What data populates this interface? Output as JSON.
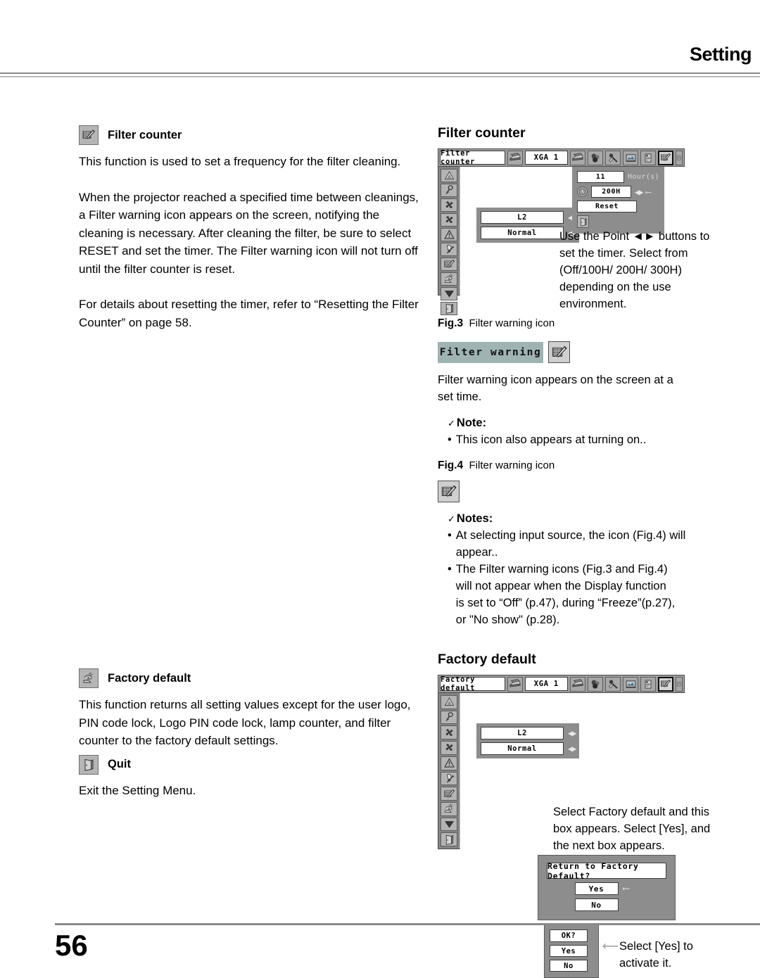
{
  "header": {
    "title": "Setting"
  },
  "footer": {
    "page_number": "56"
  },
  "left_column": {
    "sections": [
      {
        "icon": "filter-counter-icon",
        "heading": "Filter counter",
        "paragraphs": [
          "This function is used to set a frequency for the filter cleaning.",
          "When the projector reached a specified time between cleanings, a Filter warning icon appears on the screen, notifying the cleaning is necessary. After cleaning the filter, be sure to select RESET and set the timer. The Filter warning icon will not turn off until the filter counter is reset.",
          "For details about resetting the timer, refer to “Resetting the Filter Counter” on page 58."
        ]
      },
      {
        "icon": "factory-default-icon",
        "heading": "Factory default",
        "paragraphs": [
          "This function returns all setting values except for the user logo, PIN code lock, Logo PIN code lock, lamp counter, and filter counter to the factory default settings."
        ]
      },
      {
        "icon": "quit-door-icon",
        "heading": "Quit",
        "paragraphs": [
          "Exit the Setting Menu."
        ]
      }
    ]
  },
  "right_column": {
    "filter_counter": {
      "heading": "Filter counter",
      "osd": {
        "menu_title": "Filter counter",
        "source_label": "XGA 1",
        "top_bar_icons": [
          "input-source-icon",
          "color-adjust-icon",
          "image-adjust-icon",
          "screen-icon",
          "pc-adjust-icon",
          "setting-filter-icon",
          "information-icon"
        ],
        "selected_top_bar_icon": "setting-filter-icon",
        "side_icons": [
          "keystone-icon",
          "pin-code-icon",
          "fan-eco-icon",
          "fan-icon",
          "warning-icon",
          "lamp-counter-icon",
          "filter-counter-icon",
          "factory-default-icon",
          "down-arrow-icon",
          "quit-door-icon"
        ],
        "value_rows": [
          {
            "value": "L2"
          },
          {
            "value": "Normal"
          }
        ],
        "timer_panel": {
          "hours_used": "11",
          "hours_unit": "Hour(s)",
          "timer_value": "200H",
          "reset_label": "Reset",
          "clock_icon": "clock-icon",
          "quit_icon": "quit-door-icon"
        }
      },
      "caption": "Use the Point ◄► buttons to set the timer. Select from (Off/100H/ 200H/ 300H) depending on the use environment.",
      "fig3": {
        "fig_label": "Fig.3",
        "fig_title": "Filter warning icon",
        "badge_text": "Filter warning",
        "badge_icon": "filter-warning-icon",
        "badge_bg": "#9fb3b3",
        "description": "Filter warning icon appears on the screen at a set time."
      },
      "note": {
        "check": "✓",
        "title": "Note:",
        "items": [
          "This icon also appears at turning on.."
        ]
      },
      "fig4": {
        "fig_label": "Fig.4",
        "fig_title": "Filter warning icon",
        "icon": "filter-warning-icon"
      },
      "notes": {
        "check": "✓",
        "title": "Notes:",
        "items": [
          "At selecting input source, the icon (Fig.4) will appear..",
          "The Filter warning icons (Fig.3 and Fig.4) will not appear when the Display function is set to “Off” (p.47), during “Freeze”(p.27), or \"No show\" (p.28)."
        ]
      }
    },
    "factory_default": {
      "heading": "Factory default",
      "osd": {
        "menu_title": "Factory default",
        "source_label": "XGA 1",
        "top_bar_icons": [
          "input-source-icon",
          "color-adjust-icon",
          "image-adjust-icon",
          "screen-icon",
          "pc-adjust-icon",
          "setting-filter-icon",
          "information-icon"
        ],
        "selected_top_bar_icon": "setting-filter-icon",
        "side_icons": [
          "keystone-icon",
          "pin-code-icon",
          "fan-eco-icon",
          "fan-icon",
          "warning-icon",
          "lamp-counter-icon",
          "filter-counter-icon",
          "factory-default-icon",
          "down-arrow-icon",
          "quit-door-icon"
        ],
        "value_rows": [
          {
            "value": "L2"
          },
          {
            "value": "Normal"
          }
        ]
      },
      "caption": "Select Factory default and this box appears. Select [Yes], and the next box appears.",
      "confirm_dialog": {
        "question": "Return to Factory Default?",
        "yes_label": "Yes",
        "no_label": "No",
        "selected": "Yes"
      },
      "ok_dialog": {
        "question": "OK?",
        "yes_label": "Yes",
        "no_label": "No",
        "selected": "Yes"
      },
      "ok_caption": "Select [Yes] to activate it."
    }
  }
}
